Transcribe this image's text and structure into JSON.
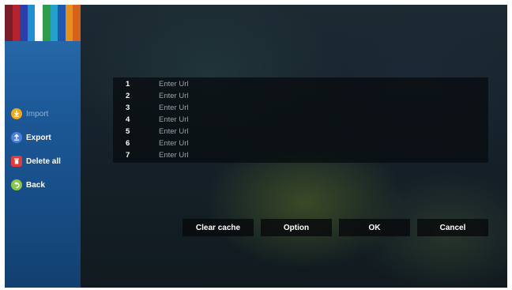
{
  "sidebar": {
    "stripe_colors": [
      "#7a1d2a",
      "#b3242e",
      "#2a3fa8",
      "#1f8fd0",
      "#ffffff",
      "#2f9c4a",
      "#25a0c8",
      "#1e56b0",
      "#e58f1e",
      "#d6611a"
    ],
    "items": [
      {
        "label": "Import",
        "icon": "import-icon",
        "color": "#f2a81f",
        "enabled": false
      },
      {
        "label": "Export",
        "icon": "export-icon",
        "color": "#4c7fe0",
        "enabled": true
      },
      {
        "label": "Delete all",
        "icon": "delete-icon",
        "color": "#e23b3b",
        "enabled": true
      },
      {
        "label": "Back",
        "icon": "back-icon",
        "color": "#8bc64a",
        "enabled": true
      }
    ]
  },
  "url_list": {
    "rows": [
      {
        "number": "1",
        "placeholder": "Enter Url"
      },
      {
        "number": "2",
        "placeholder": "Enter Url"
      },
      {
        "number": "3",
        "placeholder": "Enter Url"
      },
      {
        "number": "4",
        "placeholder": "Enter Url"
      },
      {
        "number": "5",
        "placeholder": "Enter Url"
      },
      {
        "number": "6",
        "placeholder": "Enter Url"
      },
      {
        "number": "7",
        "placeholder": "Enter Url"
      }
    ]
  },
  "buttons": {
    "clear_cache": "Clear cache",
    "option": "Option",
    "ok": "OK",
    "cancel": "Cancel"
  }
}
